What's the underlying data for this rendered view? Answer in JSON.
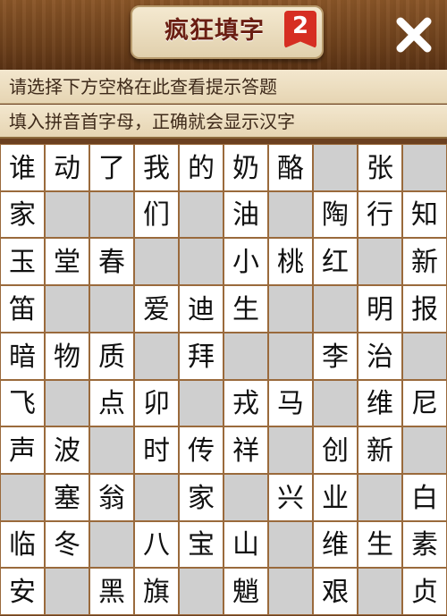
{
  "header": {
    "title": "疯狂填字",
    "badge": "2",
    "close_icon": "close-icon"
  },
  "hints": {
    "line1": "请选择下方空格在此查看提示答题",
    "line2": "填入拼音首字母，正确就会显示汉字"
  },
  "grid": {
    "rows": [
      [
        "谁",
        "动",
        "了",
        "我",
        "的",
        "奶",
        "酪",
        "",
        "张",
        ""
      ],
      [
        "家",
        "",
        "",
        "们",
        "",
        "油",
        "",
        "陶",
        "行",
        "知"
      ],
      [
        "玉",
        "堂",
        "春",
        "",
        "",
        "小",
        "桃",
        "红",
        "",
        "新"
      ],
      [
        "笛",
        "",
        "",
        "爱",
        "迪",
        "生",
        "",
        "",
        "明",
        "报"
      ],
      [
        "暗",
        "物",
        "质",
        "",
        "拜",
        "",
        "",
        "李",
        "治",
        ""
      ],
      [
        "飞",
        "",
        "点",
        "卯",
        "",
        "戎",
        "马",
        "",
        "维",
        "尼"
      ],
      [
        "声",
        "波",
        "",
        "时",
        "传",
        "祥",
        "",
        "创",
        "新",
        ""
      ],
      [
        "",
        "塞",
        "翁",
        "",
        "家",
        "",
        "兴",
        "业",
        "",
        "白"
      ],
      [
        "临",
        "冬",
        "",
        "八",
        "宝",
        "山",
        "",
        "维",
        "生",
        "素"
      ],
      [
        "安",
        "",
        "黑",
        "旗",
        "",
        "魈",
        "",
        "艰",
        "",
        "贞"
      ]
    ]
  },
  "colors": {
    "filled_cell": "#ffffff",
    "blank_cell": "#cfcfcf",
    "wood": "#7a4b24",
    "title_red": "#d62e22"
  }
}
